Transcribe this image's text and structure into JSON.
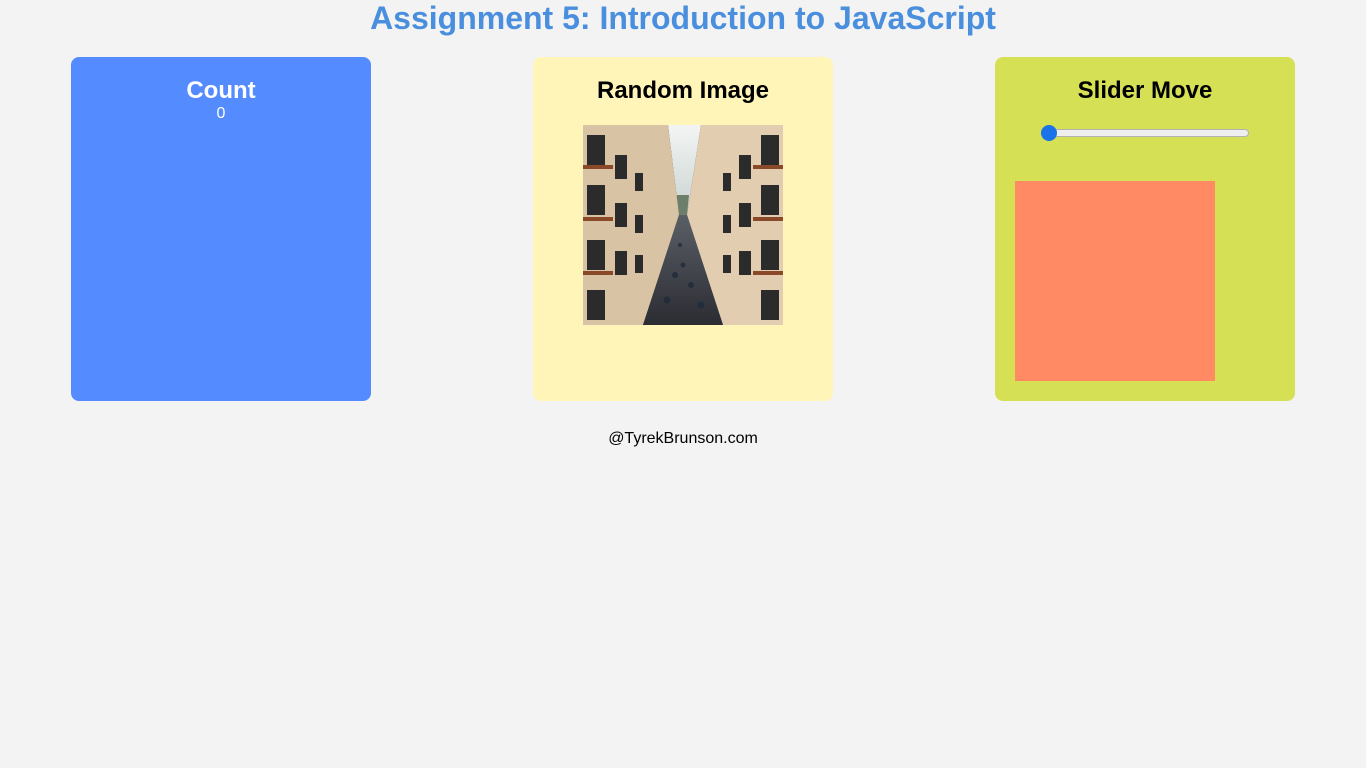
{
  "page": {
    "title": "Assignment 5: Introduction to JavaScript",
    "footer": "@TyrekBrunson.com"
  },
  "count_card": {
    "title": "Count",
    "value": "0",
    "bg_color": "#548bff"
  },
  "image_card": {
    "title": "Random Image",
    "image_alt": "narrow street between apartment buildings with balconies",
    "bg_color": "#fff5b8"
  },
  "slider_card": {
    "title": "Slider Move",
    "slider_value": 0,
    "box_color": "#ff8a64",
    "bg_color": "#d6e055"
  }
}
